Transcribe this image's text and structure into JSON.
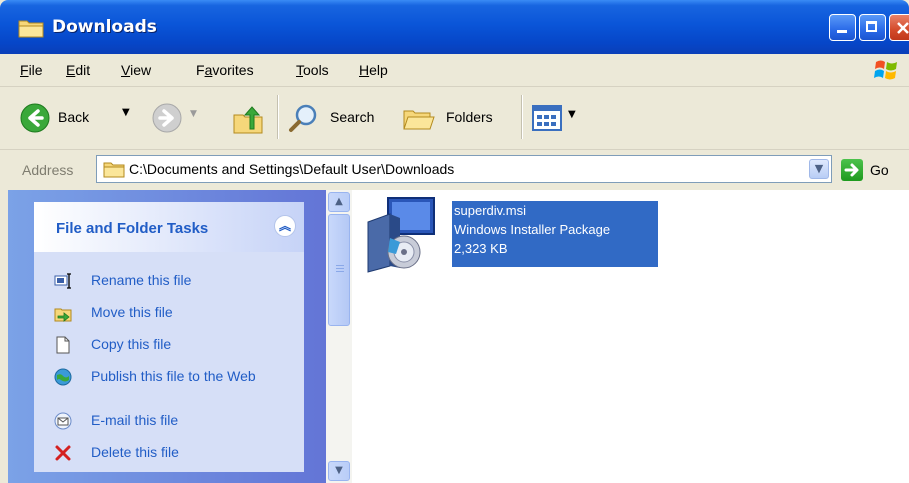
{
  "window": {
    "title": "Downloads"
  },
  "menu": {
    "items": [
      {
        "label": "File",
        "u": "F",
        "rest": "ile"
      },
      {
        "label": "Edit",
        "u": "E",
        "rest": "dit"
      },
      {
        "label": "View",
        "u": "V",
        "rest": "iew"
      },
      {
        "label": "Favorites",
        "pre": "F",
        "u": "a",
        "rest": "vorites"
      },
      {
        "label": "Tools",
        "u": "T",
        "rest": "ools"
      },
      {
        "label": "Help",
        "u": "H",
        "rest": "elp"
      }
    ]
  },
  "toolbar": {
    "back_label": "Back",
    "search_label": "Search",
    "folders_label": "Folders"
  },
  "address": {
    "label": "Address",
    "value": "C:\\Documents and Settings\\Default User\\Downloads",
    "go_label": "Go"
  },
  "tasks": {
    "title": "File and Folder Tasks",
    "items": [
      {
        "label": "Rename this file",
        "icon": "rename-icon"
      },
      {
        "label": "Move this file",
        "icon": "move-icon"
      },
      {
        "label": "Copy this file",
        "icon": "copy-icon"
      },
      {
        "label": "Publish this file to the Web",
        "icon": "publish-web-icon"
      },
      {
        "label": "E-mail this file",
        "icon": "email-icon"
      },
      {
        "label": "Delete this file",
        "icon": "delete-icon"
      }
    ]
  },
  "file": {
    "name": "superdiv.msi",
    "type": "Windows Installer Package",
    "size": "2,323 KB"
  },
  "colors": {
    "title_bar": "#0a55d8",
    "task_link": "#215dc6",
    "selection": "#316ac5"
  }
}
